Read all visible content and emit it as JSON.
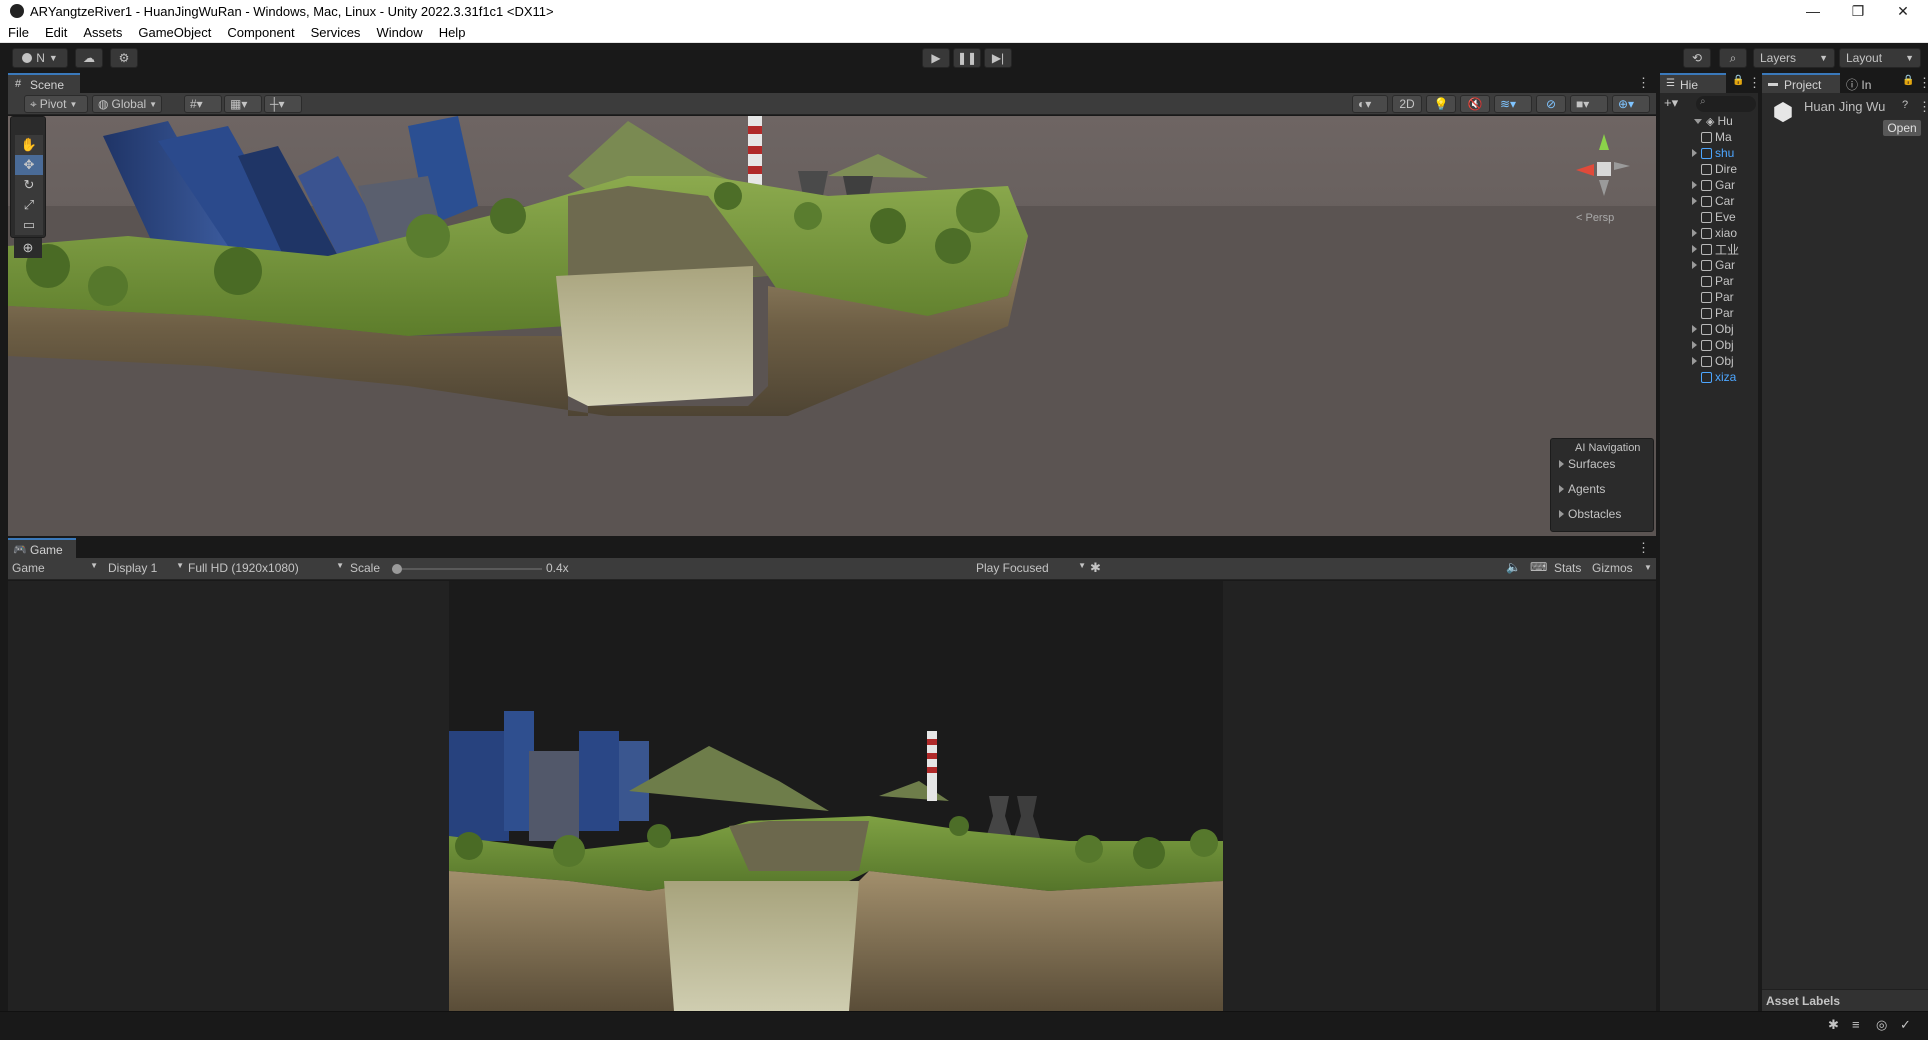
{
  "window": {
    "title": "ARYangtzeRiver1 - HuanJingWuRan - Windows, Mac, Linux - Unity 2022.3.31f1c1 <DX11>",
    "controls": [
      "minimize-icon",
      "maximize-icon",
      "close-icon"
    ]
  },
  "menu": [
    "File",
    "Edit",
    "Assets",
    "GameObject",
    "Component",
    "Services",
    "Window",
    "Help"
  ],
  "toolbar": {
    "account_label": "N",
    "play_controls": [
      "play-icon",
      "pause-icon",
      "step-icon"
    ],
    "layers_label": "Layers",
    "layout_label": "Layout"
  },
  "scene": {
    "tab_label": "Scene",
    "pivot_label": "Pivot",
    "global_label": "Global",
    "mode_2d_label": "2D",
    "gizmo_label": "< Persp",
    "tools": [
      "hand-tool-icon",
      "move-tool-icon",
      "rotate-tool-icon",
      "scale-tool-icon",
      "rect-tool-icon",
      "transform-tool-icon"
    ],
    "ai_navigation": {
      "title": "AI Navigation",
      "items": [
        "Surfaces",
        "Agents",
        "Obstacles"
      ]
    }
  },
  "game": {
    "tab_label": "Game",
    "view_select": "Game",
    "display_select": "Display 1",
    "resolution_select": "Full HD (1920x1080)",
    "scale_label": "Scale",
    "scale_value": "0.4x",
    "scale_level": 0.0,
    "play_focused": "Play Focused",
    "stats_label": "Stats",
    "gizmos_label": "Gizmos"
  },
  "hierarchy": {
    "tab_label": "Hie",
    "root": "Hu",
    "items": [
      {
        "label": "Ma",
        "expandable": false,
        "highlight": false
      },
      {
        "label": "shu",
        "expandable": true,
        "highlight": true
      },
      {
        "label": "Dire",
        "expandable": false,
        "highlight": false
      },
      {
        "label": "Gar",
        "expandable": true,
        "highlight": false
      },
      {
        "label": "Car",
        "expandable": true,
        "highlight": false
      },
      {
        "label": "Eve",
        "expandable": false,
        "highlight": false
      },
      {
        "label": "xiao",
        "expandable": true,
        "highlight": false
      },
      {
        "label": "工业",
        "expandable": true,
        "highlight": false
      },
      {
        "label": "Gar",
        "expandable": true,
        "highlight": false
      },
      {
        "label": "Par",
        "expandable": false,
        "highlight": false
      },
      {
        "label": "Par",
        "expandable": false,
        "highlight": false
      },
      {
        "label": "Par",
        "expandable": false,
        "highlight": false
      },
      {
        "label": "Obj",
        "expandable": true,
        "highlight": false
      },
      {
        "label": "Obj",
        "expandable": true,
        "highlight": false
      },
      {
        "label": "Obj",
        "expandable": true,
        "highlight": false
      },
      {
        "label": "xiza",
        "expandable": false,
        "highlight": true
      }
    ]
  },
  "project": {
    "tab_label": "Project",
    "inspector_tab_label": "In",
    "asset_name": "Huan Jing Wu",
    "open_button": "Open",
    "asset_labels": "Asset Labels"
  },
  "colors": {
    "accent": "#3a79bb",
    "highlight_text": "#4da6ff"
  }
}
